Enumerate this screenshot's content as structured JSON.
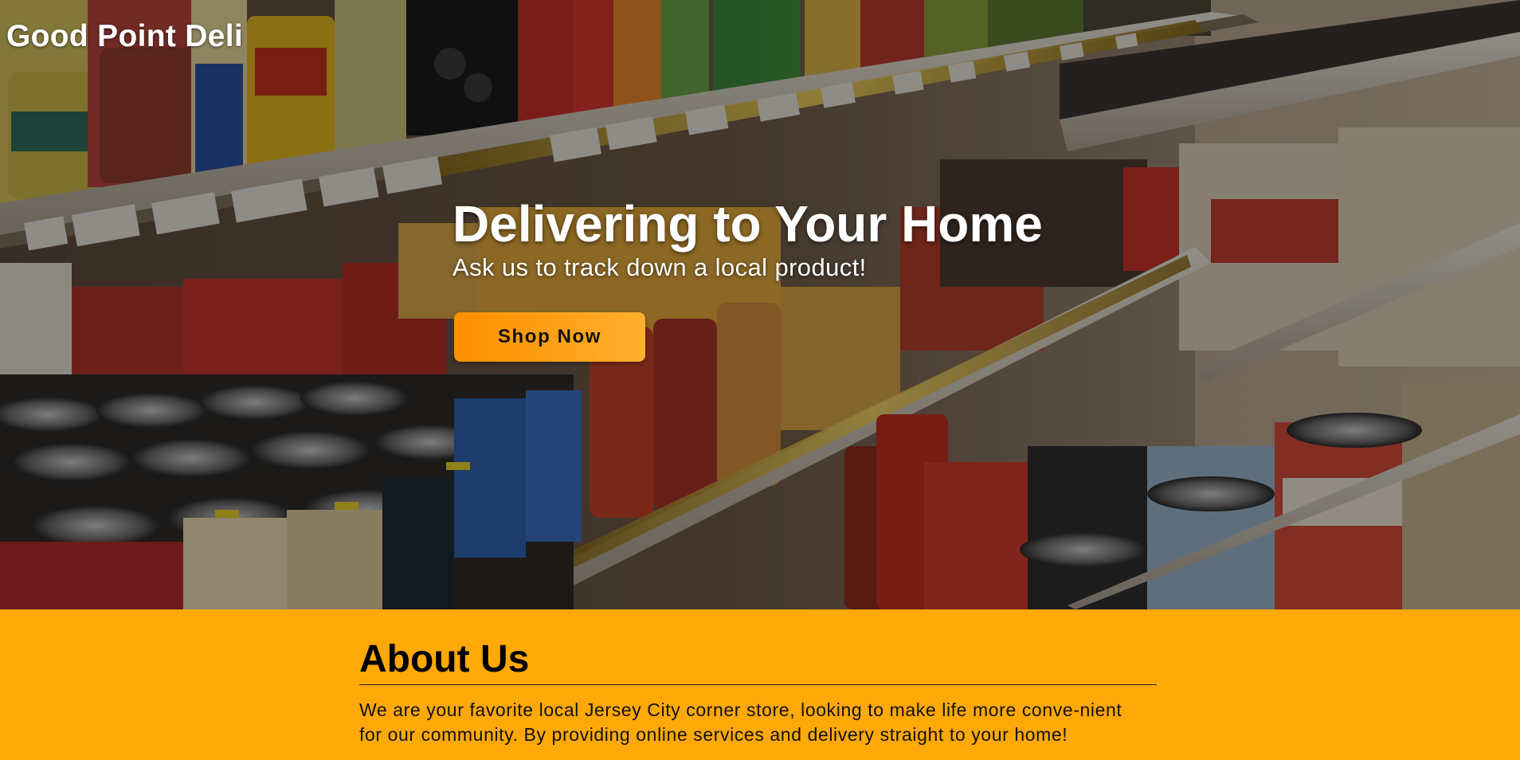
{
  "header": {
    "brand_name": "Good Point Deli"
  },
  "hero": {
    "image_description": "grocery-shelf-photo",
    "title": "Delivering to Your Home",
    "subtitle": "Ask us to track down a local product!",
    "cta_label": "Shop Now"
  },
  "about": {
    "heading": "About Us",
    "text": "We are your favorite local Jersey City corner store, looking to make life more conve-nient for our community. By providing online services and delivery straight to your home!"
  },
  "colors": {
    "accent": "#ffa908",
    "button_start": "#ff8f00",
    "button_end": "#ffb02e",
    "text_light": "#ffffff",
    "text_dark": "#000000"
  }
}
